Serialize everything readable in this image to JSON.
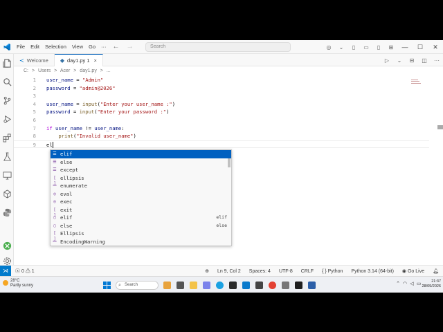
{
  "menu": [
    "File",
    "Edit",
    "Selection",
    "View",
    "Go"
  ],
  "search": {
    "placeholder": "Search"
  },
  "tabs": [
    {
      "label": "Welcome"
    },
    {
      "label": "day1.py 1"
    }
  ],
  "breadcrumb": [
    "C:",
    ">",
    "Users",
    ">",
    "Acer",
    ">",
    "day1.py",
    ">",
    "..."
  ],
  "editor": {
    "lines": [
      {
        "n": "1",
        "tokens": [
          {
            "t": "user_name",
            "c": "v"
          },
          {
            "t": " = ",
            "c": "o"
          },
          {
            "t": "\"Admin\"",
            "c": "s"
          }
        ]
      },
      {
        "n": "2",
        "tokens": [
          {
            "t": "password",
            "c": "v"
          },
          {
            "t": " = ",
            "c": "o"
          },
          {
            "t": "\"admin@2026\"",
            "c": "s"
          }
        ]
      },
      {
        "n": "3",
        "tokens": []
      },
      {
        "n": "4",
        "tokens": [
          {
            "t": "user_name",
            "c": "v"
          },
          {
            "t": " = ",
            "c": "o"
          },
          {
            "t": "input",
            "c": "f"
          },
          {
            "t": "(",
            "c": "o"
          },
          {
            "t": "\"Enter your user_name :\"",
            "c": "s"
          },
          {
            "t": ")",
            "c": "o"
          }
        ]
      },
      {
        "n": "5",
        "tokens": [
          {
            "t": "password",
            "c": "v"
          },
          {
            "t": " = ",
            "c": "o"
          },
          {
            "t": "input",
            "c": "f"
          },
          {
            "t": "(",
            "c": "o"
          },
          {
            "t": "\"Enter your password :\"",
            "c": "s"
          },
          {
            "t": ")",
            "c": "o"
          }
        ]
      },
      {
        "n": "6",
        "tokens": []
      },
      {
        "n": "7",
        "tokens": [
          {
            "t": "if",
            "c": "k"
          },
          {
            "t": " ",
            "c": "o"
          },
          {
            "t": "user_name",
            "c": "v"
          },
          {
            "t": " != ",
            "c": "o"
          },
          {
            "t": "user_name",
            "c": "v"
          },
          {
            "t": ":",
            "c": "o"
          }
        ]
      },
      {
        "n": "8",
        "tokens": [
          {
            "t": "    ",
            "c": "o"
          },
          {
            "t": "print",
            "c": "f"
          },
          {
            "t": "(",
            "c": "o"
          },
          {
            "t": "\"Invalid user_name\"",
            "c": "s"
          },
          {
            "t": ")",
            "c": "o"
          }
        ]
      },
      {
        "n": "9",
        "tokens": [
          {
            "t": "el",
            "c": "o"
          }
        ]
      }
    ]
  },
  "suggestions": [
    {
      "label": "elif",
      "icon": "keyword-icon",
      "detail": ""
    },
    {
      "label": "else",
      "icon": "keyword-icon",
      "detail": ""
    },
    {
      "label": "except",
      "icon": "keyword-icon",
      "detail": ""
    },
    {
      "label": "ellipsis",
      "icon": "variable-icon",
      "detail": ""
    },
    {
      "label": "enumerate",
      "icon": "class-icon",
      "detail": ""
    },
    {
      "label": "eval",
      "icon": "function-icon",
      "detail": ""
    },
    {
      "label": "exec",
      "icon": "function-icon",
      "detail": ""
    },
    {
      "label": "exit",
      "icon": "variable-icon",
      "detail": ""
    },
    {
      "label": "elif",
      "icon": "snippet-icon",
      "detail": "elif"
    },
    {
      "label": "else",
      "icon": "snippet-icon",
      "detail": "else"
    },
    {
      "label": "Ellipsis",
      "icon": "variable-icon",
      "detail": ""
    },
    {
      "label": "EncodingWarning",
      "icon": "class-icon",
      "detail": ""
    }
  ],
  "status": {
    "errors": "0",
    "warnings": "1",
    "position": "Ln 9, Col 2",
    "spaces": "Spaces: 4",
    "encoding": "UTF-8",
    "eol": "CRLF",
    "language": "Python",
    "interpreter": "Python 3.14 (64-bit)",
    "golive": "Go Live"
  },
  "taskbar": {
    "weather_temp": "28°C",
    "weather_desc": "Partly sunny",
    "search": "Search",
    "time": "21:37",
    "date": "28/09/2026"
  },
  "colors": {
    "accent": "#005fb8",
    "selection": "#0060c0",
    "remote": "#007acc"
  }
}
